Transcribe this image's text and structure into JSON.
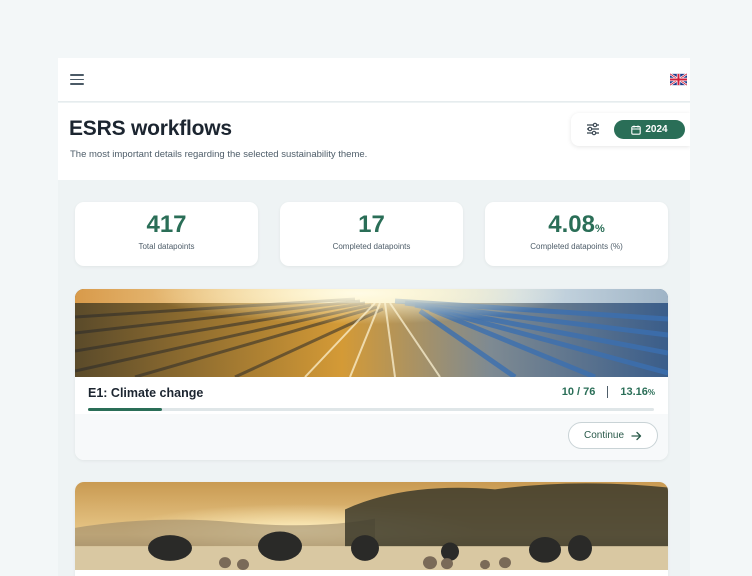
{
  "topbar": {
    "menu_icon": "hamburger-menu-icon",
    "language_icon": "uk-flag-icon"
  },
  "header": {
    "title": "ESRS workflows",
    "subtitle": "The most important details regarding the selected sustainability theme.",
    "filter_icon": "sliders-icon",
    "year_icon": "calendar-icon",
    "year": "2024"
  },
  "stats": [
    {
      "value": "417",
      "unit": "",
      "label": "Total datapoints"
    },
    {
      "value": "17",
      "unit": "",
      "label": "Completed datapoints"
    },
    {
      "value": "4.08",
      "unit": "%",
      "label": "Completed datapoints (%)"
    }
  ],
  "themes": [
    {
      "title": "E1: Climate change",
      "progress_text": "10 / 76",
      "percent": "13.16",
      "percent_unit": "%",
      "progress_fraction": 0.1316,
      "continue_label": "Continue",
      "continue_icon": "arrow-right-icon"
    }
  ],
  "colors": {
    "accent": "#2a6e57",
    "background": "#eef3f4",
    "card": "#ffffff",
    "text": "#1c2530"
  }
}
